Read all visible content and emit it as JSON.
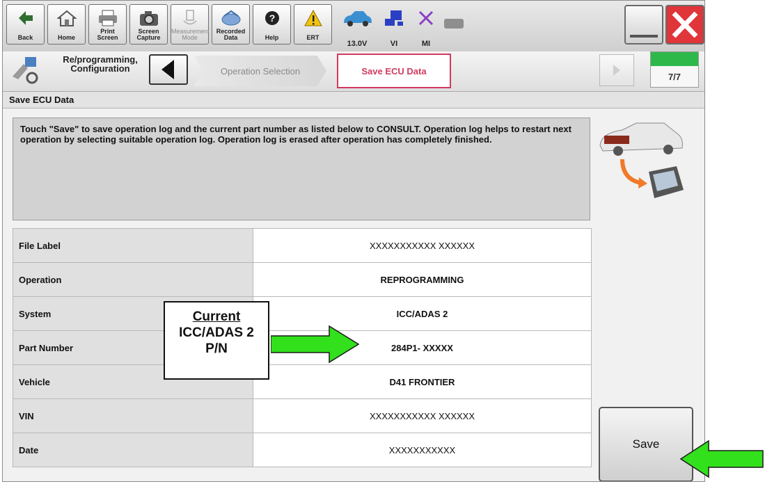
{
  "toolbar": {
    "buttons": [
      {
        "label": "Back",
        "icon": "back-arrow-icon"
      },
      {
        "label": "Home",
        "icon": "home-icon"
      },
      {
        "label": "Print Screen",
        "icon": "printer-icon"
      },
      {
        "label": "Screen Capture",
        "icon": "camera-icon"
      },
      {
        "label": "Measurement Mode",
        "icon": "measurement-icon",
        "disabled": true
      },
      {
        "label": "Recorded Data",
        "icon": "recorded-data-icon"
      },
      {
        "label": "Help",
        "icon": "help-icon"
      },
      {
        "label": "ERT",
        "icon": "warning-icon"
      }
    ],
    "status": {
      "voltage": "13.0V",
      "vi": "VI",
      "mi": "MI"
    }
  },
  "navbar": {
    "previous_label": "Re/programming, Configuration",
    "tab_operation": "Operation Selection",
    "tab_current": "Save ECU Data",
    "page_indicator": "7/7",
    "progress_fraction": 1.0
  },
  "screen_title": "Save ECU Data",
  "message": "Touch \"Save\" to save operation log and the current part number as listed below to CONSULT. Operation log helps to restart next operation by selecting suitable operation log. Operation log is erased after operation has completely finished.",
  "table": [
    {
      "label": "File Label",
      "value": "XXXXXXXXXXX XXXXXX",
      "bold": false
    },
    {
      "label": "Operation",
      "value": "REPROGRAMMING",
      "bold": true
    },
    {
      "label": "System",
      "value": "ICC/ADAS 2",
      "bold": true
    },
    {
      "label": "Part Number",
      "value": "284P1- XXXXX",
      "bold": true
    },
    {
      "label": "Vehicle",
      "value": "D41 FRONTIER",
      "bold": true
    },
    {
      "label": "VIN",
      "value": "XXXXXXXXXXX XXXXXX",
      "bold": false
    },
    {
      "label": "Date",
      "value": "XXXXXXXXXXX",
      "bold": false
    }
  ],
  "save_button": "Save",
  "annotation": {
    "line1": "Current",
    "line2": "ICC/ADAS 2",
    "line3": "P/N",
    "arrow_color": "#32e01c"
  },
  "colors": {
    "accent_tab": "#d03a5e",
    "progress": "#2fb84a",
    "close": "#e0353a"
  }
}
